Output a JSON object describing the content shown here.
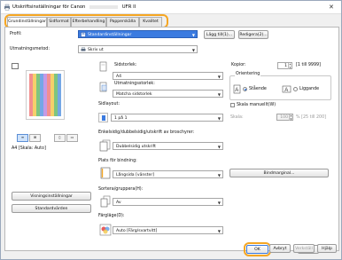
{
  "window": {
    "title": "Utskriftsinställningar för Canon",
    "title_suffix": "UFR II",
    "close_glyph": "✕"
  },
  "tabs": [
    {
      "label": "Grundinställningar",
      "active": true
    },
    {
      "label": "Sidformat",
      "active": false
    },
    {
      "label": "Efterbehandling",
      "active": false
    },
    {
      "label": "Papperskälla",
      "active": false
    },
    {
      "label": "Kvalitet",
      "active": false
    }
  ],
  "profile": {
    "label": "Profil:",
    "value": "Standardinställningar",
    "add_button": "Lägg till(1)...",
    "edit_button": "Redigera(2)..."
  },
  "output_method": {
    "label": "Utmatningsmetod:",
    "value": "Skriv ut"
  },
  "page_size": {
    "label": "Sidstorlek:",
    "value": "A4"
  },
  "output_size": {
    "label": "Utmatningsstorlek:",
    "value": "Matcha sidstorlek"
  },
  "copies": {
    "label": "Kopior:",
    "value": "1",
    "range": "[1 till 9999]"
  },
  "orientation": {
    "label": "Orientering",
    "portrait": "Stående",
    "landscape": "Liggande",
    "selected": "portrait"
  },
  "page_layout": {
    "label": "Sidlayout:",
    "value": "1 på 1"
  },
  "manual_scaling": {
    "label": "Skala manuellt(W)",
    "checked": false
  },
  "scale": {
    "label": "Skala:",
    "value": "100",
    "range": "% [25 till 200]"
  },
  "duplex": {
    "label": "Enkelsidig/dubbelsidig/utskrift av broschyrer:",
    "value": "Dubbelsidig utskrift"
  },
  "binding": {
    "label": "Plats för bindning:",
    "value": "Långsida [vänster]",
    "margin_button": "Bindmarginal..."
  },
  "collate": {
    "label": "Sortera/gruppera(H):",
    "value": "Av"
  },
  "color_mode": {
    "label": "Färgläge(D):",
    "value": "Auto [Färg/svartvitt]"
  },
  "preview": {
    "caption": "A4 [Skala: Auto]",
    "view_buttons": [
      "≡",
      "⊞",
      "▯",
      "▭"
    ],
    "settings_button": "Visningsinställningar",
    "defaults_button": "Standardvärden"
  },
  "footer": {
    "ok": "OK",
    "cancel": "Avbryt",
    "apply": "Verkställ",
    "help": "Hjälp"
  },
  "colors": {
    "highlight_ring": "#f5a623",
    "selection_blue": "#3b7be0"
  }
}
